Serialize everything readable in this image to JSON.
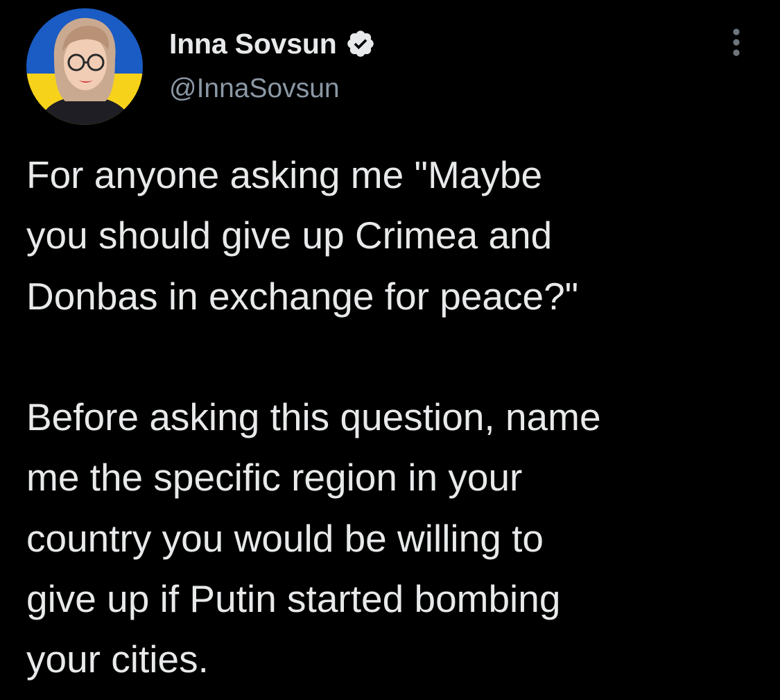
{
  "tweet": {
    "author": {
      "display_name": "Inna Sovsun",
      "handle": "@InnaSovsun",
      "verified": true,
      "verified_icon": "verified-badge-icon",
      "avatar_icon": "profile-photo"
    },
    "more_icon": "more-options-icon",
    "text_paragraphs": [
      [
        "For anyone asking me \"Maybe",
        "you should give up Crimea and",
        "Donbas in exchange for peace?\""
      ],
      [
        "Before asking this question, name",
        "me the specific region in your",
        "country you would be willing to",
        "give up if Putin started bombing",
        "your cities."
      ]
    ],
    "colors": {
      "background": "#000000",
      "text": "#e7e9ea",
      "secondary_text": "#8b98a5",
      "flag_blue": "#1a5bc4",
      "flag_yellow": "#f7d21b"
    }
  }
}
